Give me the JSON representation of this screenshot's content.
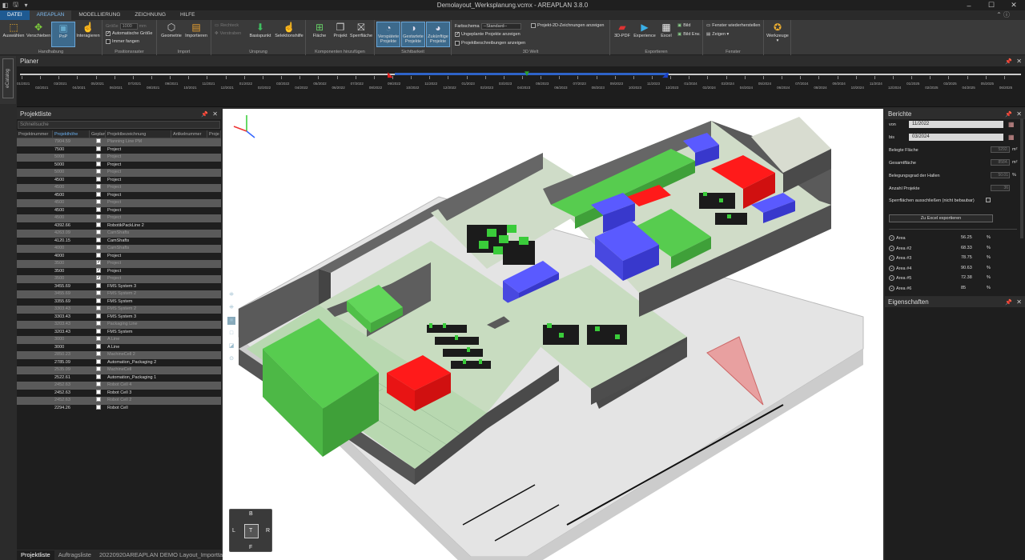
{
  "window": {
    "title": "Demolayout_Werksplanung.vcmx - AREAPLAN 3.8.0"
  },
  "ribbon_tabs": [
    "DATEI",
    "AREAPLAN",
    "MODELLIERUNG",
    "ZEICHNUNG",
    "HILFE"
  ],
  "ribbon": {
    "handhabung": {
      "label": "Handhabung",
      "auswaehlen": "Auswählen",
      "verschieben": "Verschieben",
      "pnp": "PnP",
      "interagieren": "Interagieren"
    },
    "positionsraster": {
      "label": "Positionsraster",
      "groesse": "Größe",
      "groesse_value": "1000",
      "unit": "mm",
      "auto": "Automatische Größe",
      "fangen": "Immer fangen"
    },
    "import": {
      "label": "Import",
      "geometrie": "Geometrie",
      "importieren": "Importieren"
    },
    "ursprung": {
      "label": "Ursprung",
      "rechteck": "Rechteck",
      "verstraben": "Verstraben",
      "basispunkt": "Basispunkt",
      "selektionshilfe": "Selektionshilfe"
    },
    "komponenten": {
      "label": "Komponenten hinzufügen",
      "flaeche": "Fläche",
      "projekt": "Projekt",
      "sperrflaeche": "Sperrfläche"
    },
    "sichtbarkeit": {
      "label": "Sichtbarkeit",
      "verspaetete": "Verspätete Projekte",
      "gestartete": "Gestartete Projekte",
      "zukuenftige": "Zukünftige Projekte"
    },
    "view3d": {
      "label": "3D Welt",
      "farbschema": "Farbschema",
      "farbschema_value": "--Standard--",
      "ungeplante": "Ungeplante Projekte anzeigen",
      "beschreibungen": "Projektbeschreibungen anzeigen",
      "zeichnungen": "Projekt-2D-Zeichnungen anzeigen"
    },
    "exportieren": {
      "label": "Exportieren",
      "pdf3d": "3D-PDF",
      "experience": "Experience",
      "excel": "Excel",
      "bild": "Bild",
      "bild_erw": "Bild Erw."
    },
    "fenster": {
      "label": "Fenster",
      "wiederherstellen": "Fenster wiederherstellen",
      "zeigen": "Zeigen ▾"
    },
    "werkzeuge": "Werkzeuge"
  },
  "side_tab": "eCatalog",
  "planer": {
    "title": "Planer",
    "ticks": [
      "01/2021",
      "02/2021",
      "03/2021",
      "04/2021",
      "05/2021",
      "06/2021",
      "07/2021",
      "08/2021",
      "09/2021",
      "10/2021",
      "11/2021",
      "12/2021",
      "01/2022",
      "02/2022",
      "03/2022",
      "04/2022",
      "05/2022",
      "06/2022",
      "07/2022",
      "08/2022",
      "09/2022",
      "10/2022",
      "11/2022",
      "12/2022",
      "01/2023",
      "02/2023",
      "03/2023",
      "04/2023",
      "05/2023",
      "06/2023",
      "07/2023",
      "08/2023",
      "09/2023",
      "10/2023",
      "11/2023",
      "12/2023",
      "01/2024",
      "02/2024",
      "03/2024",
      "04/2024",
      "05/2024",
      "06/2024",
      "07/2024",
      "08/2024",
      "09/2024",
      "10/2024",
      "11/2024",
      "12/2024",
      "01/2025",
      "02/2025",
      "03/2025",
      "04/2025",
      "05/2025",
      "06/2025"
    ]
  },
  "projektliste": {
    "title": "Projektliste",
    "search_placeholder": "Schnellsuche",
    "columns": [
      "Projektnummer",
      "Projekthöhe",
      "Geplant",
      "Projektbezeichnung",
      "Artikelnummer",
      "Proje"
    ],
    "rows": [
      {
        "h": "7904.59",
        "g": false,
        "name": "Planning Line PM",
        "alt": true
      },
      {
        "h": "7500",
        "g": false,
        "name": "Project",
        "alt": false
      },
      {
        "h": "5000",
        "g": false,
        "name": "Project",
        "alt": true
      },
      {
        "h": "5000",
        "g": false,
        "name": "Project",
        "alt": false
      },
      {
        "h": "5000",
        "g": false,
        "name": "Project",
        "alt": true
      },
      {
        "h": "4500",
        "g": false,
        "name": "Project",
        "alt": false
      },
      {
        "h": "4500",
        "g": false,
        "name": "Project",
        "alt": true
      },
      {
        "h": "4500",
        "g": false,
        "name": "Project",
        "alt": false
      },
      {
        "h": "4500",
        "g": false,
        "name": "Project",
        "alt": true
      },
      {
        "h": "4500",
        "g": false,
        "name": "Project",
        "alt": false
      },
      {
        "h": "4500",
        "g": false,
        "name": "Project",
        "alt": true
      },
      {
        "h": "4392.66",
        "g": false,
        "name": "RobotikPackLine 2",
        "alt": false
      },
      {
        "h": "4263.09",
        "g": false,
        "name": "CamShafts",
        "alt": true
      },
      {
        "h": "4120.15",
        "g": false,
        "name": "CamShafts",
        "alt": false
      },
      {
        "h": "4000",
        "g": false,
        "name": "CamShafts",
        "alt": true
      },
      {
        "h": "4000",
        "g": false,
        "name": "Project",
        "alt": false
      },
      {
        "h": "3500",
        "g": true,
        "name": "Project",
        "alt": true
      },
      {
        "h": "3500",
        "g": true,
        "name": "Project",
        "alt": false
      },
      {
        "h": "3500",
        "g": true,
        "name": "Project",
        "alt": true
      },
      {
        "h": "3455.69",
        "g": false,
        "name": "FMS System 3",
        "alt": false
      },
      {
        "h": "3455.69",
        "g": false,
        "name": "FMS System 2",
        "alt": true
      },
      {
        "h": "3355.69",
        "g": false,
        "name": "FMS System",
        "alt": false
      },
      {
        "h": "3303.43",
        "g": false,
        "name": "FMS System 2",
        "alt": true
      },
      {
        "h": "3303.43",
        "g": false,
        "name": "FMS System 3",
        "alt": false
      },
      {
        "h": "3203.43",
        "g": false,
        "name": "Packaging Line",
        "alt": true
      },
      {
        "h": "3203.43",
        "g": false,
        "name": "FMS System",
        "alt": false
      },
      {
        "h": "3000",
        "g": false,
        "name": "A Line",
        "alt": true
      },
      {
        "h": "3000",
        "g": false,
        "name": "A Line",
        "alt": false
      },
      {
        "h": "2850.23",
        "g": false,
        "name": "MachineCell 2",
        "alt": true
      },
      {
        "h": "2785.09",
        "g": false,
        "name": "Automation_Packaging 2",
        "alt": false
      },
      {
        "h": "2535.09",
        "g": false,
        "name": "MachineCell",
        "alt": true
      },
      {
        "h": "2522.61",
        "g": false,
        "name": "Automation_Packaging 1",
        "alt": false
      },
      {
        "h": "2452.63",
        "g": false,
        "name": "Robot Cell 4",
        "alt": true
      },
      {
        "h": "2452.63",
        "g": false,
        "name": "Robot Cell 3",
        "alt": false
      },
      {
        "h": "2452.63",
        "g": false,
        "name": "Robot Cell 2",
        "alt": true
      },
      {
        "h": "2294.26",
        "g": false,
        "name": "Robot Cell",
        "alt": false
      }
    ]
  },
  "bottom_tabs": [
    "Projektliste",
    "Auftragsliste",
    "20220920AREAPLAN DEMO Layout_Importta..."
  ],
  "berichte": {
    "title": "Berichte",
    "von_label": "von",
    "von": "11/2022",
    "bis_label": "bis",
    "bis": "03/2024",
    "belegte": "Belegte Fläche",
    "belegte_v": "5292.",
    "gesamt": "Gesamtfläche",
    "gesamt_v": "8584.",
    "grad": "Belegungsgrad der Hallen",
    "grad_v": "50.01",
    "anzahl": "Anzahl Projekte",
    "anzahl_v": "36",
    "sperr": "Sperrflächen ausschließen (nicht bebaubar)",
    "m2": "m²",
    "pct": "%",
    "export": "Zu Excel exportieren",
    "areas": [
      {
        "name": "Area",
        "v": "56.25"
      },
      {
        "name": "Area #2",
        "v": "68.33"
      },
      {
        "name": "Area #3",
        "v": "78.75"
      },
      {
        "name": "Area #4",
        "v": "90.63"
      },
      {
        "name": "Area #5",
        "v": "72.38"
      },
      {
        "name": "Area #6",
        "v": "85"
      }
    ]
  },
  "eigenschaften": {
    "title": "Eigenschaften"
  },
  "navcube": {
    "top": "B",
    "left": "L",
    "center": "T",
    "right": "R",
    "bottom": "F"
  }
}
